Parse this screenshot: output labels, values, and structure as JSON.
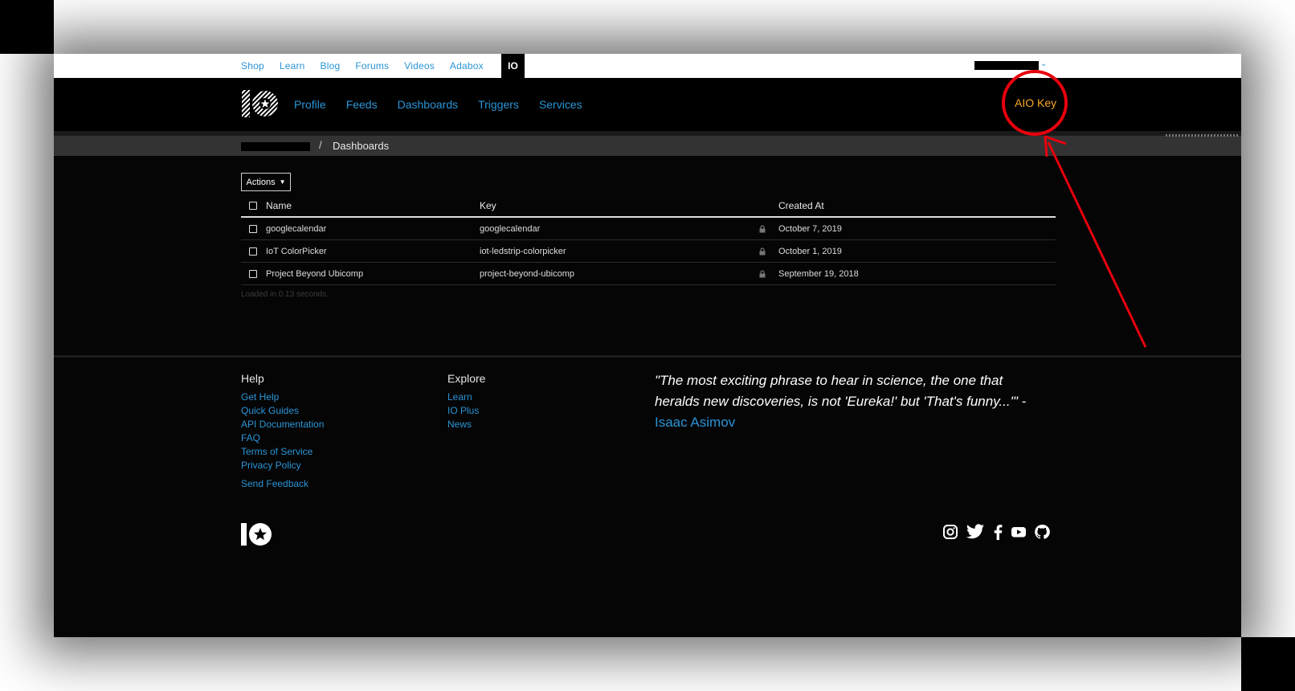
{
  "topnav": {
    "links": [
      "Shop",
      "Learn",
      "Blog",
      "Forums",
      "Videos",
      "Adabox"
    ],
    "io_tab": "IO"
  },
  "header": {
    "nav": [
      "Profile",
      "Feeds",
      "Dashboards",
      "Triggers",
      "Services"
    ],
    "aio_key": "AIO Key"
  },
  "breadcrumb": {
    "separator": "/",
    "current": "Dashboards"
  },
  "actions": {
    "label": "Actions",
    "caret": "▼"
  },
  "table": {
    "headers": {
      "name": "Name",
      "key": "Key",
      "created": "Created At"
    },
    "rows": [
      {
        "name": "googlecalendar",
        "key": "googlecalendar",
        "created": "October 7, 2019"
      },
      {
        "name": "IoT ColorPicker",
        "key": "iot-ledstrip-colorpicker",
        "created": "October 1, 2019"
      },
      {
        "name": "Project Beyond Ubicomp",
        "key": "project-beyond-ubicomp",
        "created": "September 19, 2018"
      }
    ]
  },
  "status": {
    "loaded": "Loaded in 0.13 seconds."
  },
  "footer": {
    "help": {
      "title": "Help",
      "links": [
        "Get Help",
        "Quick Guides",
        "API Documentation",
        "FAQ",
        "Terms of Service",
        "Privacy Policy"
      ],
      "feedback": "Send Feedback"
    },
    "explore": {
      "title": "Explore",
      "links": [
        "Learn",
        "IO Plus",
        "News"
      ]
    },
    "quote": {
      "text": "\"The most exciting phrase to hear in science, the one that heralds new discoveries, is not 'Eureka!' but 'That's funny...'\" - ",
      "author": "Isaac Asimov"
    },
    "social_icons": [
      "instagram-icon",
      "twitter-icon",
      "facebook-icon",
      "youtube-icon",
      "github-icon"
    ]
  },
  "colors": {
    "link": "#2a94d6",
    "aio_key": "#f7a823",
    "annotation": "#e8000d",
    "background": "#050505"
  }
}
